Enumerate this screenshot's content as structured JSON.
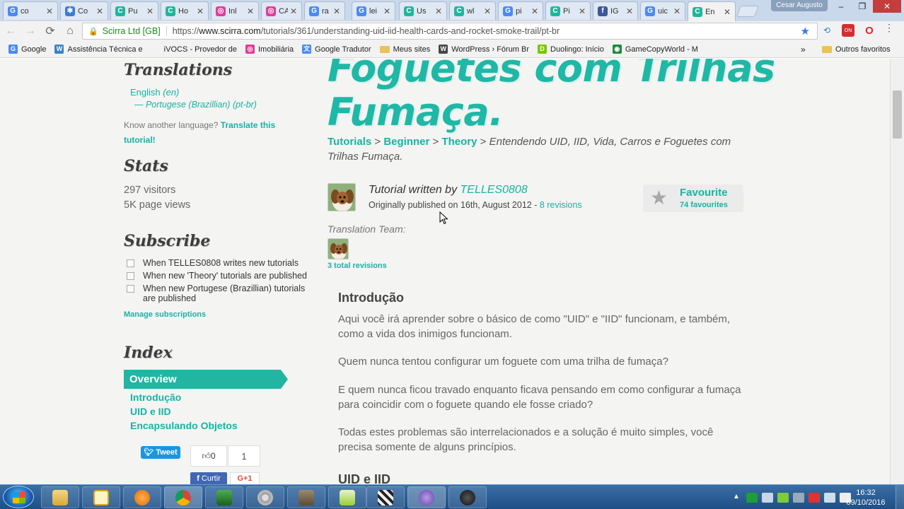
{
  "tabs": [
    {
      "label": "co",
      "color": "#4a8af4",
      "glyph": "G"
    },
    {
      "label": "Co",
      "color": "#3d7dd6",
      "glyph": "✱"
    },
    {
      "label": "Pu",
      "color": "#20b69c",
      "glyph": "C"
    },
    {
      "label": "Ho",
      "color": "#20b69c",
      "glyph": "C"
    },
    {
      "label": "Inl",
      "color": "#e03d9a",
      "glyph": "◎"
    },
    {
      "label": "CA",
      "color": "#e03d9a",
      "glyph": "◎"
    },
    {
      "label": "ra",
      "color": "#4a8af4",
      "glyph": "G"
    },
    {
      "label": "lei",
      "color": "#4a8af4",
      "glyph": "G"
    },
    {
      "label": "Us",
      "color": "#20b69c",
      "glyph": "C"
    },
    {
      "label": "wl",
      "color": "#20b69c",
      "glyph": "C"
    },
    {
      "label": "pi",
      "color": "#4a8af4",
      "glyph": "G"
    },
    {
      "label": "Pi",
      "color": "#20b69c",
      "glyph": "C"
    },
    {
      "label": "IG",
      "color": "#3b5998",
      "glyph": "f"
    },
    {
      "label": "uic",
      "color": "#4a8af4",
      "glyph": "G"
    },
    {
      "label": "En",
      "color": "#20b69c",
      "glyph": "C"
    }
  ],
  "window": {
    "user": "Cesar Augusto",
    "min": "–",
    "max": "❐",
    "close": "✕"
  },
  "toolbar": {
    "back": "←",
    "forward": "→",
    "reload": "⟳",
    "home": "⌂",
    "site_identity": "Scirra Ltd [GB]",
    "url_scheme": "https://",
    "url_host": "www.scirra.com",
    "url_path": "/tutorials/361/understanding-uid-iid-health-cards-and-rocket-smoke-trail/pt-br",
    "star": "★"
  },
  "bookmarks": [
    {
      "label": "Google",
      "color": "#4a8af4",
      "glyph": "G"
    },
    {
      "label": "Assistência Técnica e",
      "color": "#3b82c4",
      "glyph": "W"
    },
    {
      "label": "iVOCS - Provedor de",
      "color": "#f2f2f2",
      "glyph": ""
    },
    {
      "label": "Imobiliária",
      "color": "#e03d9a",
      "glyph": "◎"
    },
    {
      "label": "Google Tradutor",
      "color": "#4a8af4",
      "glyph": "文"
    },
    {
      "label": "Meus sites",
      "folder": true
    },
    {
      "label": "WordPress › Fórum Br",
      "color": "#464646",
      "glyph": "W"
    },
    {
      "label": "Duolingo: Início",
      "color": "#78c800",
      "glyph": "D"
    },
    {
      "label": "GameCopyWorld - M",
      "color": "#1e8a3e",
      "glyph": "◉"
    }
  ],
  "bookmarks_more": "»",
  "bookmarks_other": "Outros favoritos",
  "sidebar": {
    "translations_heading": "Translations",
    "lang_en": "English",
    "lang_en_code": "(en)",
    "lang_pt": "— Portugese (Brazillian) (pt-br)",
    "know_another": "Know another language?",
    "translate_link": "Translate this",
    "translate_link2": "tutorial!",
    "stats_heading": "Stats",
    "visitors": "297 visitors",
    "page_views": "5K page views",
    "subscribe_heading": "Subscribe",
    "sub1": "When TELLES0808 writes new tutorials",
    "sub2": "When new 'Theory' tutorials are published",
    "sub3a": "When new Portugese (Brazillian) tutorials",
    "sub3b": "are published",
    "manage": "Manage subscriptions",
    "index_heading": "Index",
    "index_active": "Overview",
    "index_items": [
      "Introdução",
      "UID e IID",
      "Encapsulando Objetos"
    ],
    "tweet": "Tweet",
    "like_count": "0",
    "share_count": "1",
    "curtir": "Curtir",
    "gplus": "G+1"
  },
  "main": {
    "title_line1": "Foguetes com Trilhas",
    "title_line2": "Fumaça.",
    "crumb_tutorials": "Tutorials",
    "crumb_beginner": "Beginner",
    "crumb_theory": "Theory",
    "crumb_sep": ">",
    "crumb_current": "Entendendo UID, IID, Vida, Carros e Foguetes com Trilhas Fumaça.",
    "written_by": "Tutorial written by",
    "author": "TELLES0808",
    "published": "Originally published on 16th, August 2012 -",
    "revisions": "8 revisions",
    "favourite": "Favourite",
    "favourites_count": "74 favourites",
    "translation_team": "Translation Team:",
    "total_revisions": "3 total revisions",
    "intro_heading": "Introdução",
    "para1": "Aqui você irá aprender sobre o básico de como \"UID\" e \"IID\" funcionam, e também, como a vida dos inimigos funcionam.",
    "para2": "Quem nunca tentou configurar um foguete com uma trilha de fumaça?",
    "para3": "E quem nunca ficou travado enquanto ficava pensando em como configurar a fumaça para coincidir com o foguete quando ele fosse criado?",
    "para4": "Todas estes problemas são interrelacionados e a solução é muito simples, você precisa somente de alguns princípios.",
    "uid_heading": "UID e IID"
  },
  "taskbar": {
    "time": "16:32",
    "date": "09/10/2016"
  },
  "colors": {
    "accent": "#17b3a3",
    "overview_bg": "#22b5a2",
    "taskbar": "#1e4f86"
  }
}
